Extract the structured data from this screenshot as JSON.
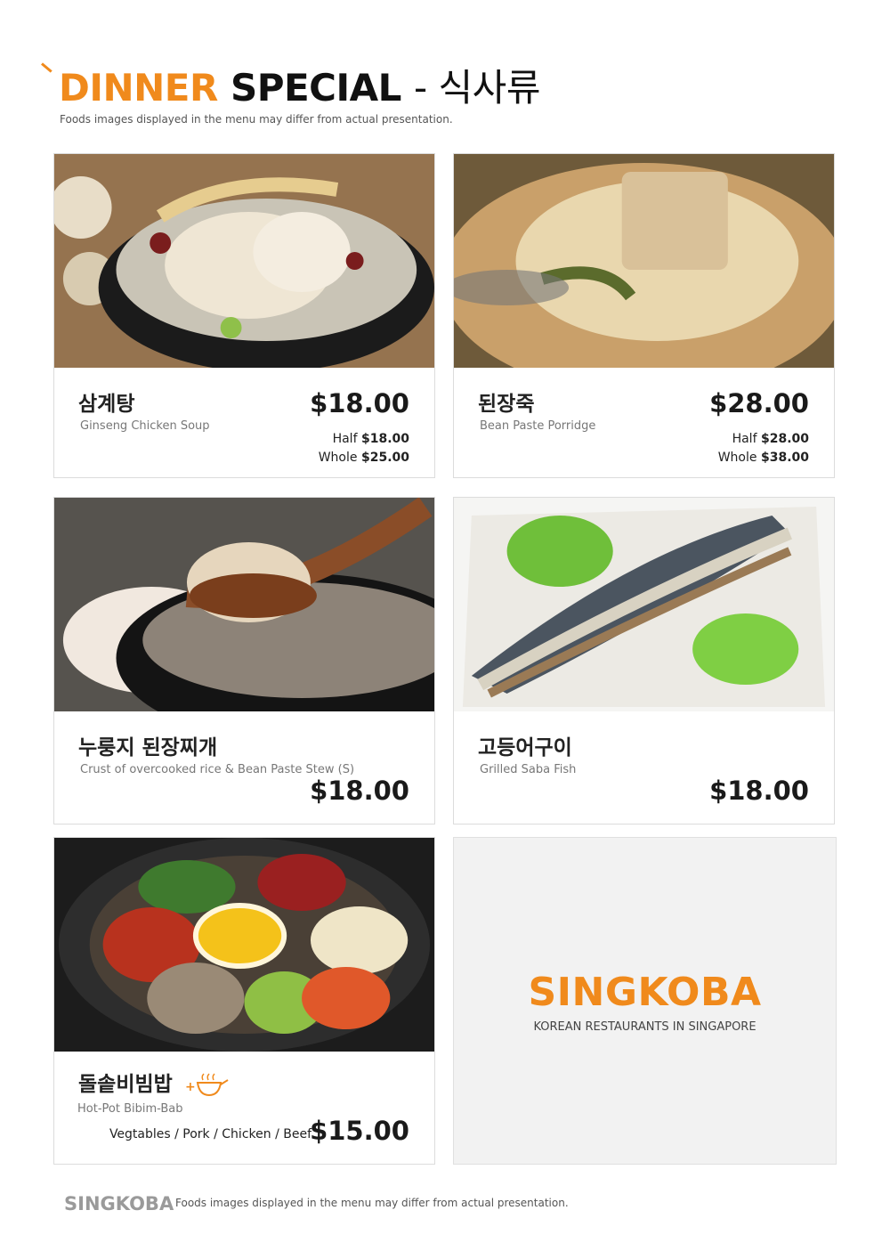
{
  "header": {
    "title_part1": "DINNER",
    "title_part2": "SPECIAL",
    "title_part3": "- 식사류",
    "subtitle": "Foods images displayed in the menu may differ from actual presentation."
  },
  "items": [
    {
      "name_kr": "삼계탕",
      "name_en": "Ginseng Chicken Soup",
      "price": "$18.00",
      "half_label": "Half",
      "half_price": "$18.00",
      "whole_label": "Whole",
      "whole_price": "$25.00"
    },
    {
      "name_kr": "된장죽",
      "name_en": "Bean Paste Porridge",
      "price": "$28.00",
      "half_label": "Half",
      "half_price": "$28.00",
      "whole_label": "Whole",
      "whole_price": "$38.00"
    },
    {
      "name_kr": "누룽지 된장찌개",
      "name_en": "Crust of overcooked rice & Bean Paste Stew (S)",
      "price": "$18.00"
    },
    {
      "name_kr": "고등어구이",
      "name_en": "Grilled Saba Fish",
      "price": "$18.00"
    },
    {
      "name_kr": "돌솥비빔밥",
      "name_en": "Hot-Pot Bibim-Bab",
      "variants": "Vegtables / Pork / Chicken / Beef",
      "price": "$15.00"
    }
  ],
  "brand": {
    "name": "SINGKOBA",
    "tagline": "KOREAN RESTAURANTS IN SINGAPORE"
  },
  "footer": {
    "brand": "SINGKOBA",
    "note": "Foods images displayed in the menu may differ from actual presentation."
  },
  "colors": {
    "accent": "#f08a1c",
    "card_border": "#dcdcdc",
    "brand_panel": "#f2f2f2"
  },
  "icons": [
    "hot-pot-icon"
  ]
}
